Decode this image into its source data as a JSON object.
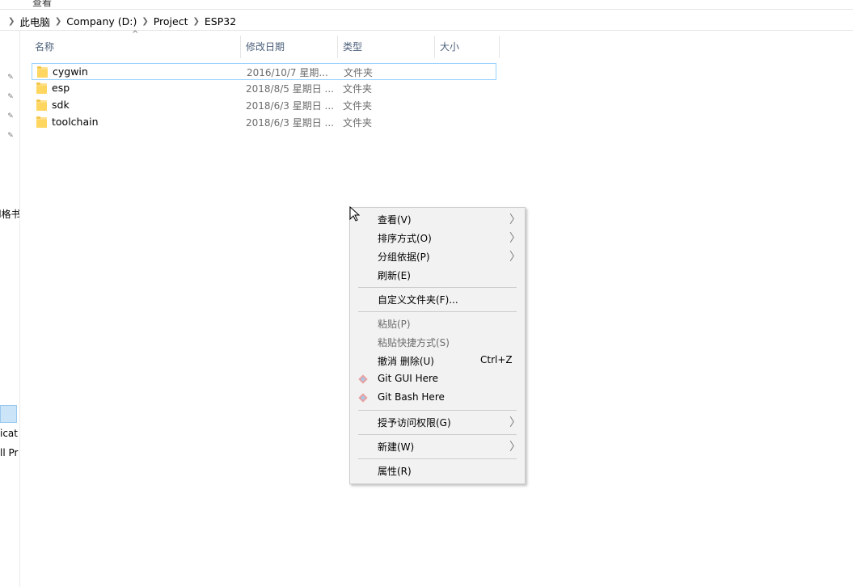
{
  "topstrip": {
    "frag1": "^",
    "frag2": "查看"
  },
  "address": {
    "crumbs": [
      "此电脑",
      "Company (D:)",
      "Project",
      "ESP32"
    ]
  },
  "nav": {
    "frag_grid": "d格书",
    "frag_applicat": "icat",
    "frag_allpr": "ll Pr"
  },
  "columns": {
    "name": "名称",
    "date": "修改日期",
    "type": "类型",
    "size": "大小",
    "sort_indicator": "^"
  },
  "files": [
    {
      "name": "cygwin",
      "date": "2016/10/7 星期...",
      "type": "文件夹"
    },
    {
      "name": "esp",
      "date": "2018/8/5 星期日 ...",
      "type": "文件夹"
    },
    {
      "name": "sdk",
      "date": "2018/6/3 星期日 ...",
      "type": "文件夹"
    },
    {
      "name": "toolchain",
      "date": "2018/6/3 星期日 ...",
      "type": "文件夹"
    }
  ],
  "context_menu": {
    "view": "查看(V)",
    "sort_by": "排序方式(O)",
    "group_by": "分组依据(P)",
    "refresh": "刷新(E)",
    "customize_folder": "自定义文件夹(F)...",
    "paste": "粘贴(P)",
    "paste_shortcut": "粘贴快捷方式(S)",
    "undo_delete": "撤消 删除(U)",
    "undo_shortcut": "Ctrl+Z",
    "git_gui": "Git GUI Here",
    "git_bash": "Git Bash Here",
    "give_access": "授予访问权限(G)",
    "new": "新建(W)",
    "properties": "属性(R)"
  }
}
